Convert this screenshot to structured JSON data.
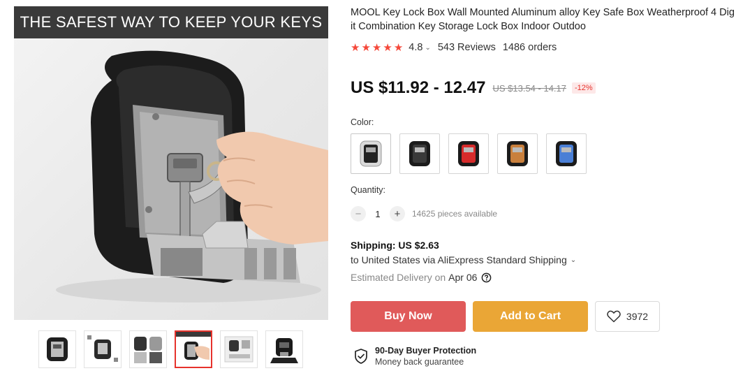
{
  "gallery": {
    "banner_text": "THE SAFEST WAY TO KEEP YOUR KEYS",
    "thumbnail_count": 6,
    "active_thumbnail": 4
  },
  "product": {
    "title": "MOOL Key Lock Box Wall Mounted Aluminum alloy Key Safe Box Weatherproof 4 Dig it Combination Key Storage Lock Box Indoor Outdoo",
    "rating": "4.8",
    "rating_stars": 5,
    "reviews": "543 Reviews",
    "orders": "1486 orders"
  },
  "price": {
    "current": "US $11.92 - 12.47",
    "original": "US $13.54 - 14.17",
    "discount": "-12%"
  },
  "color": {
    "label": "Color:",
    "options": [
      "silver",
      "black",
      "red",
      "orange",
      "blue"
    ]
  },
  "quantity": {
    "label": "Quantity:",
    "minus": "−",
    "value": "1",
    "plus": "+",
    "available": "14625 pieces available"
  },
  "shipping": {
    "title": "Shipping: US $2.63",
    "line": "to United States via AliExpress Standard Shipping",
    "delivery_label": "Estimated Delivery on",
    "delivery_date": "Apr 06"
  },
  "actions": {
    "buy_now": "Buy Now",
    "add_to_cart": "Add to Cart",
    "wishlist_count": "3972"
  },
  "protection": {
    "title": "90-Day Buyer Protection",
    "subtitle": "Money back guarantee"
  },
  "colors": {
    "buy_now": "#e05a5a",
    "add_to_cart": "#eaa636",
    "stars": "#f5483a",
    "discount_text": "#e6322c",
    "active_thumb_border": "#e6322c",
    "banner_bg": "#3a3a3a"
  }
}
